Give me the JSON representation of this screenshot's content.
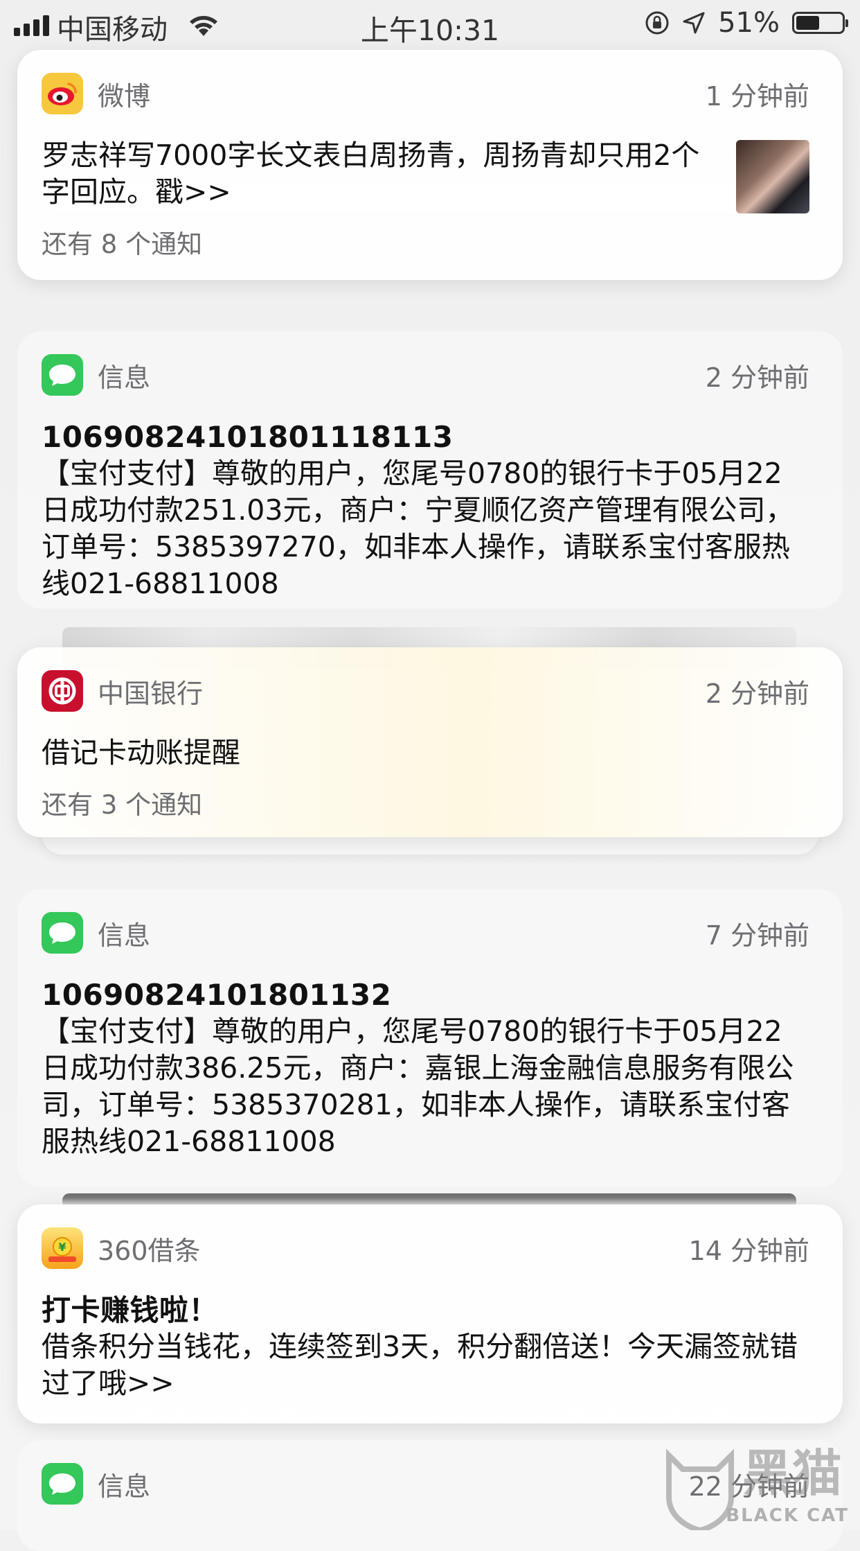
{
  "status_bar": {
    "carrier": "中国移动",
    "time": "上午10:31",
    "battery": "51%",
    "battery_level": 0.51
  },
  "notifications": [
    {
      "app": "微博",
      "icon": "weibo-icon",
      "ago": "1 分钟前",
      "body": "罗志祥写7000字长文表白周扬青，周扬青却只用2个字回应。戳>>",
      "more": "还有 8 个通知"
    },
    {
      "app": "信息",
      "icon": "messages-icon",
      "ago": "2 分钟前",
      "title": "106908241018011181​13",
      "body": "【宝付支付】尊敬的用户，您尾号0780的银行卡于05月22日成功付款251.03元，商户：宁夏顺亿资产管理有限公司，订单号：5385397270，如非本人操作，请联系宝付客服热线021-68811008"
    },
    {
      "app": "中国银行",
      "icon": "bank-of-china-icon",
      "ago": "2 分钟前",
      "body": "借记卡动账提醒",
      "more": "还有 3 个通知"
    },
    {
      "app": "信息",
      "icon": "messages-icon",
      "ago": "7 分钟前",
      "title": "10690824101801132",
      "body": "【宝付支付】尊敬的用户，您尾号0780的银行卡于05月22日成功付款386.25元，商户：嘉银上海金融信息服务有限公司，订单号：5385370281，如非本人操作，请联系宝付客服热线021-68811008"
    },
    {
      "app": "360借条",
      "icon": "360-jietiao-icon",
      "ago": "14 分钟前",
      "title": "打卡赚钱啦！",
      "body": "借条积分当钱花，连续签到3天，积分翻倍送！今天漏签就错过了哦>>"
    },
    {
      "app": "信息",
      "icon": "messages-icon",
      "ago": "22 分钟前"
    }
  ],
  "watermark": {
    "cn": "黑猫",
    "en": "BLACK CAT"
  }
}
